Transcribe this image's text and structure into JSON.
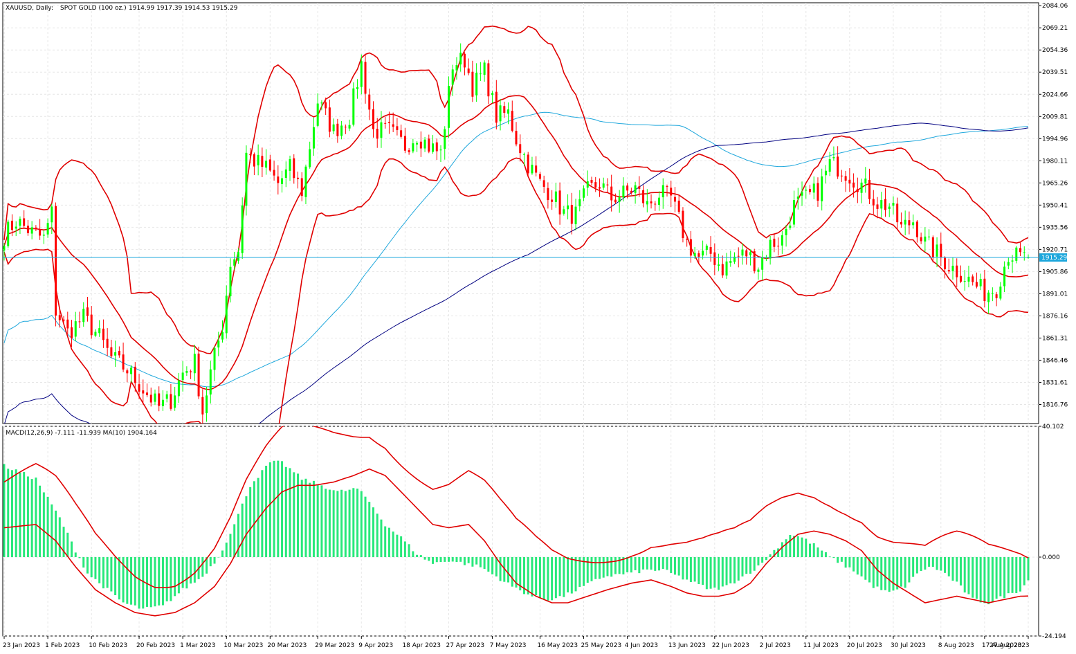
{
  "header": {
    "symbol": "XAUUSD, Daily:",
    "description": "SPOT GOLD (100 oz.)",
    "ohlc": "1914.99 1917.39 1914.53 1915.29"
  },
  "macd_header": "MACD(12,26,9) -7.111 -11.939 MA(10) 1904.164",
  "colors": {
    "up_candle": "#00ff00",
    "down_candle": "#ff0000",
    "bands": "#e00000",
    "ma_light": "#1ea7dc",
    "ma_dark": "#000080",
    "histogram": "#27e87a",
    "price_line": "#1ea7dc",
    "price_label_bg": "#1ea7dc"
  },
  "current_price": "1915.29",
  "chart_data": [
    {
      "type": "candlestick",
      "panel": "price",
      "y_range": [
        1804,
        2086
      ],
      "y_ticks": [
        "2084.06",
        "2069.21",
        "2054.36",
        "2039.51",
        "2024.66",
        "2009.81",
        "1994.96",
        "1980.11",
        "1965.26",
        "1950.41",
        "1935.56",
        "1920.71",
        "1905.86",
        "1891.01",
        "1876.16",
        "1861.31",
        "1846.46",
        "1831.61",
        "1816.76"
      ],
      "x_labels": [
        "23 Jan 2023",
        "1 Feb 2023",
        "10 Feb 2023",
        "20 Feb 2023",
        "1 Mar 2023",
        "10 Mar 2023",
        "20 Mar 2023",
        "29 Mar 2023",
        "9 Apr 2023",
        "18 Apr 2023",
        "27 Apr 2023",
        "7 May 2023",
        "16 May 2023",
        "25 May 2023",
        "4 Jun 2023",
        "13 Jun 2023",
        "22 Jun 2023",
        "2 Jul 2023",
        "11 Jul 2023",
        "20 Jul 2023",
        "30 Jul 2023",
        "8 Aug 2023",
        "17 Aug 2023",
        "27 Aug 2023"
      ],
      "close_anchors": [
        [
          0,
          1930
        ],
        [
          3,
          1940
        ],
        [
          7,
          1932
        ],
        [
          10,
          1928
        ],
        [
          12,
          1945
        ],
        [
          13,
          1880
        ],
        [
          16,
          1865
        ],
        [
          20,
          1875
        ],
        [
          24,
          1862
        ],
        [
          27,
          1848
        ],
        [
          31,
          1840
        ],
        [
          35,
          1827
        ],
        [
          39,
          1815
        ],
        [
          42,
          1820
        ],
        [
          45,
          1838
        ],
        [
          48,
          1845
        ],
        [
          50,
          1812
        ],
        [
          52,
          1838
        ],
        [
          55,
          1870
        ],
        [
          57,
          1912
        ],
        [
          59,
          1920
        ],
        [
          61,
          1985
        ],
        [
          63,
          1980
        ],
        [
          66,
          1975
        ],
        [
          69,
          1965
        ],
        [
          72,
          1975
        ],
        [
          75,
          1960
        ],
        [
          79,
          2020
        ],
        [
          83,
          2000
        ],
        [
          87,
          2010
        ],
        [
          90,
          2045
        ],
        [
          93,
          2000
        ],
        [
          97,
          2000
        ],
        [
          101,
          1990
        ],
        [
          104,
          1998
        ],
        [
          107,
          1990
        ],
        [
          110,
          1985
        ],
        [
          113,
          2045
        ],
        [
          116,
          2048
        ],
        [
          118,
          2030
        ],
        [
          121,
          2040
        ],
        [
          124,
          2010
        ],
        [
          127,
          2012
        ],
        [
          129,
          1995
        ],
        [
          132,
          1978
        ],
        [
          135,
          1965
        ],
        [
          138,
          1958
        ],
        [
          141,
          1945
        ],
        [
          144,
          1944
        ],
        [
          147,
          1960
        ],
        [
          150,
          1965
        ],
        [
          153,
          1955
        ],
        [
          156,
          1958
        ],
        [
          159,
          1962
        ],
        [
          162,
          1950
        ],
        [
          165,
          1958
        ],
        [
          168,
          1955
        ],
        [
          172,
          1925
        ],
        [
          175,
          1915
        ],
        [
          178,
          1918
        ],
        [
          181,
          1908
        ],
        [
          184,
          1915
        ],
        [
          187,
          1918
        ],
        [
          190,
          1910
        ],
        [
          193,
          1924
        ],
        [
          196,
          1928
        ],
        [
          199,
          1950
        ],
        [
          202,
          1955
        ],
        [
          205,
          1960
        ],
        [
          208,
          1978
        ],
        [
          211,
          1975
        ],
        [
          214,
          1968
        ],
        [
          217,
          1962
        ],
        [
          220,
          1952
        ],
        [
          223,
          1950
        ],
        [
          226,
          1935
        ],
        [
          229,
          1940
        ],
        [
          232,
          1925
        ],
        [
          235,
          1918
        ],
        [
          238,
          1910
        ],
        [
          241,
          1905
        ],
        [
          244,
          1898
        ],
        [
          247,
          1892
        ],
        [
          250,
          1895
        ],
        [
          253,
          1918
        ],
        [
          256,
          1915
        ],
        [
          258,
          1915.29
        ]
      ],
      "series": [
        {
          "name": "Bollinger Band"
        },
        {
          "name": "Moving Average"
        },
        {
          "name": "Moving Average"
        }
      ]
    },
    {
      "type": "bar",
      "panel": "MACD",
      "y_range": [
        -24.194,
        40.102
      ],
      "y_ticks": [
        "40.102",
        "0.000",
        "-24.194"
      ],
      "hist_anchors": [
        [
          0,
          28
        ],
        [
          8,
          24
        ],
        [
          14,
          12
        ],
        [
          18,
          2
        ],
        [
          21,
          -5
        ],
        [
          26,
          -10
        ],
        [
          30,
          -14
        ],
        [
          35,
          -16
        ],
        [
          40,
          -15
        ],
        [
          45,
          -10
        ],
        [
          50,
          -6
        ],
        [
          54,
          0
        ],
        [
          58,
          10
        ],
        [
          62,
          22
        ],
        [
          67,
          29
        ],
        [
          70,
          29
        ],
        [
          75,
          24
        ],
        [
          80,
          22
        ],
        [
          84,
          20
        ],
        [
          89,
          21
        ],
        [
          92,
          17
        ],
        [
          96,
          10
        ],
        [
          100,
          6
        ],
        [
          104,
          1
        ],
        [
          108,
          -2
        ],
        [
          112,
          -1
        ],
        [
          116,
          -2
        ],
        [
          120,
          -3
        ],
        [
          124,
          -6
        ],
        [
          128,
          -9
        ],
        [
          133,
          -12
        ],
        [
          137,
          -13
        ],
        [
          141,
          -12
        ],
        [
          146,
          -9
        ],
        [
          151,
          -6
        ],
        [
          157,
          -5
        ],
        [
          162,
          -4
        ],
        [
          166,
          -4
        ],
        [
          170,
          -6
        ],
        [
          174,
          -8
        ],
        [
          178,
          -10
        ],
        [
          182,
          -9
        ],
        [
          186,
          -6
        ],
        [
          190,
          -3
        ],
        [
          194,
          2
        ],
        [
          198,
          7
        ],
        [
          201,
          6
        ],
        [
          205,
          3
        ],
        [
          208,
          0
        ],
        [
          211,
          -2
        ],
        [
          215,
          -5
        ],
        [
          219,
          -9
        ],
        [
          223,
          -11
        ],
        [
          227,
          -9
        ],
        [
          231,
          -4
        ],
        [
          234,
          -3
        ],
        [
          237,
          -5
        ],
        [
          240,
          -8
        ],
        [
          244,
          -13
        ],
        [
          248,
          -14
        ],
        [
          252,
          -12
        ],
        [
          256,
          -10
        ],
        [
          258,
          -7.111
        ]
      ],
      "signal_anchors": [
        [
          0,
          9
        ],
        [
          8,
          10
        ],
        [
          13,
          5
        ],
        [
          18,
          -3
        ],
        [
          23,
          -10
        ],
        [
          28,
          -14
        ],
        [
          33,
          -17
        ],
        [
          38,
          -18
        ],
        [
          43,
          -17
        ],
        [
          48,
          -14
        ],
        [
          53,
          -9
        ],
        [
          57,
          -2
        ],
        [
          61,
          7
        ],
        [
          66,
          15
        ],
        [
          70,
          20
        ],
        [
          74,
          22
        ],
        [
          78,
          22
        ],
        [
          83,
          23
        ],
        [
          88,
          25
        ],
        [
          92,
          27
        ],
        [
          96,
          25
        ],
        [
          100,
          20
        ],
        [
          104,
          15
        ],
        [
          108,
          10
        ],
        [
          112,
          9
        ],
        [
          117,
          10
        ],
        [
          121,
          5
        ],
        [
          125,
          -2
        ],
        [
          129,
          -8
        ],
        [
          134,
          -12
        ],
        [
          138,
          -14
        ],
        [
          142,
          -14
        ],
        [
          147,
          -12
        ],
        [
          152,
          -10
        ],
        [
          158,
          -8
        ],
        [
          163,
          -7
        ],
        [
          168,
          -9
        ],
        [
          172,
          -11
        ],
        [
          176,
          -12
        ],
        [
          180,
          -12
        ],
        [
          184,
          -11
        ],
        [
          188,
          -8
        ],
        [
          192,
          -2
        ],
        [
          196,
          3
        ],
        [
          200,
          7
        ],
        [
          204,
          8
        ],
        [
          208,
          7
        ],
        [
          212,
          5
        ],
        [
          216,
          2
        ],
        [
          220,
          -4
        ],
        [
          224,
          -8
        ],
        [
          228,
          -11
        ],
        [
          232,
          -14
        ],
        [
          236,
          -13
        ],
        [
          240,
          -12
        ],
        [
          244,
          -13
        ],
        [
          248,
          -14
        ],
        [
          252,
          -13
        ],
        [
          256,
          -12
        ],
        [
          258,
          -11.939
        ]
      ],
      "series": [
        {
          "name": "MACD"
        },
        {
          "name": "Signal"
        }
      ]
    }
  ]
}
